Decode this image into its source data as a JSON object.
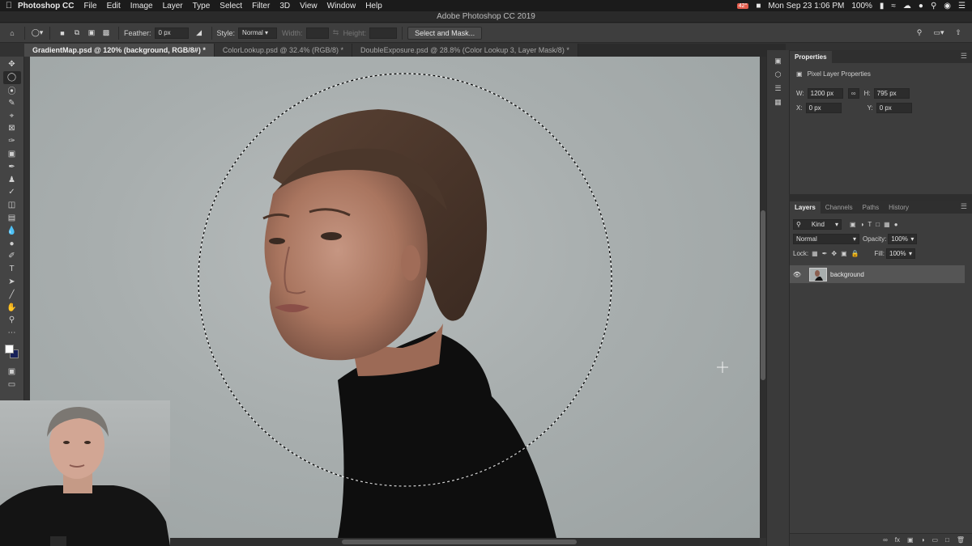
{
  "menubar": {
    "apple": "",
    "app_name": "Photoshop CC",
    "items": [
      "File",
      "Edit",
      "Image",
      "Layer",
      "Type",
      "Select",
      "Filter",
      "3D",
      "View",
      "Window",
      "Help"
    ],
    "temperature": "42°",
    "clock": "Mon Sep 23  1:06 PM",
    "battery": "100%"
  },
  "window": {
    "title": "Adobe Photoshop CC 2019"
  },
  "options": {
    "feather_label": "Feather:",
    "feather_value": "0 px",
    "style_label": "Style:",
    "style_value": "Normal",
    "width_label": "Width:",
    "height_label": "Height:",
    "select_mask_label": "Select and Mask..."
  },
  "tabs": [
    {
      "label": "GradientMap.psd @ 120% (background, RGB/8#) *"
    },
    {
      "label": "ColorLookup.psd @ 32.4% (RGB/8) *"
    },
    {
      "label": "DoubleExposure.psd @ 28.8% (Color Lookup 3, Layer Mask/8) *"
    }
  ],
  "colors": {
    "foreground": "#ffffff",
    "background": "#17215a",
    "canvas_bg": "#a8aeae"
  },
  "properties": {
    "tab_label": "Properties",
    "section_label": "Pixel Layer Properties",
    "w_label": "W:",
    "w_value": "1200 px",
    "h_label": "H:",
    "h_value": "795 px",
    "x_label": "X:",
    "x_value": "0 px",
    "y_label": "Y:",
    "y_value": "0 px"
  },
  "layers": {
    "tabs": [
      "Layers",
      "Channels",
      "Paths",
      "History"
    ],
    "filter_value": "Kind",
    "blend_mode": "Normal",
    "opacity_label": "Opacity:",
    "opacity_value": "100%",
    "lock_label": "Lock:",
    "fill_label": "Fill:",
    "fill_value": "100%",
    "items": [
      {
        "name": "background"
      }
    ]
  }
}
